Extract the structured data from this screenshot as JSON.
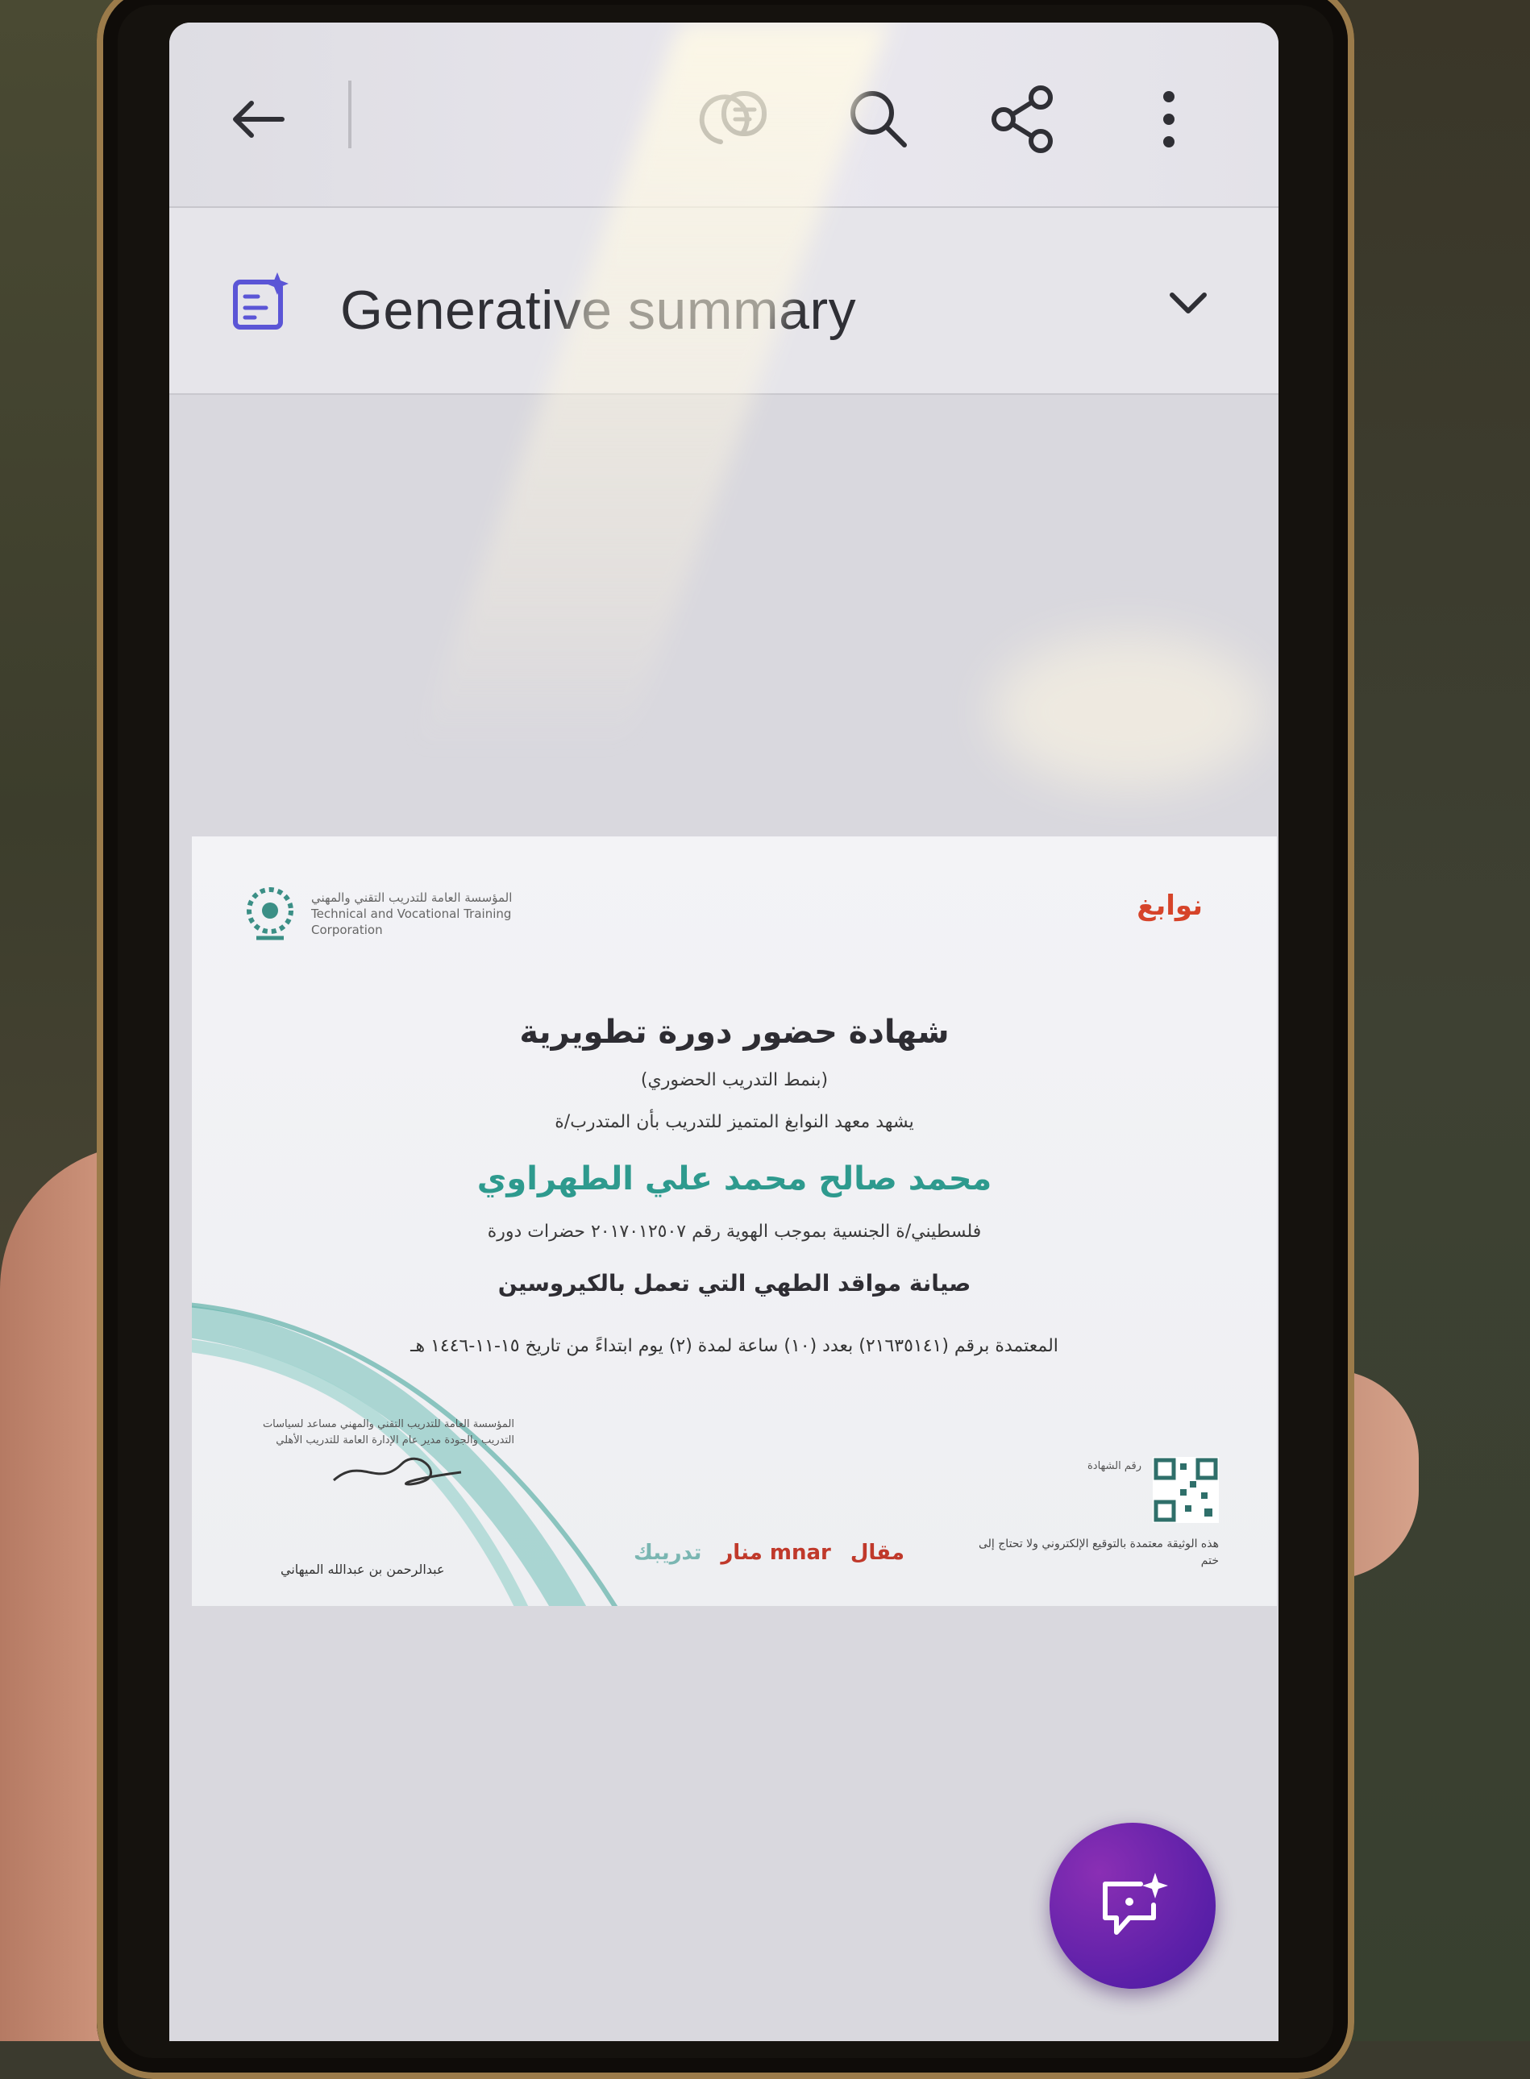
{
  "toolbar": {
    "back_icon": "arrow-left-icon",
    "comment_icon": "comment-bubbles-icon",
    "search_icon": "search-icon",
    "share_icon": "share-icon",
    "more_icon": "more-vertical-icon"
  },
  "summary": {
    "label": "Generative summary",
    "icon": "generative-summary-icon",
    "chevron": "chevron-down-icon"
  },
  "certificate": {
    "title": "شهادة حضور دورة تطويرية",
    "subtitle": "(بنمط التدريب الحضوري)",
    "intro": "يشهد معهد النوابغ المتميز للتدريب بأن المتدرب/ة",
    "name": "محمد صالح محمد علي الطهراوي",
    "nationality_line": "فلسطيني/ة الجنسية بموجب الهوية رقم ٢٠١٧٠١٢٥٠٧ حضرات دورة",
    "course": "صيانة مواقد الطهي التي تعمل بالكيروسين",
    "approved_line": "المعتمدة برقم (٢١٦٣٥١٤١) بعدد (١٠) ساعة لمدة (٢) يوم ابتداءً من تاريخ ١٥-١١-١٤٤٦ هـ",
    "org_left": "المؤسسة العامة للتدريب التقني والمهني Technical and Vocational Training Corporation",
    "org_right_logo": "نوابغ",
    "signature_block": "المؤسسة العامة للتدريب التقني والمهني مساعد لسياسات التدريب والجودة مدير عام الإدارة العامة للتدريب الأهلي",
    "signatory_name": "عبدالرحمن بن عبدالله الميهاني",
    "qr_label": "رقم الشهادة",
    "qr_note": "هذه الوثيقة معتمدة بالتوقيع الإلكتروني ولا تحتاج إلى ختم",
    "logos": [
      "تدريبك",
      "منار mnar",
      "مقال"
    ]
  },
  "fab": {
    "icon": "ai-assistant-chat-icon"
  }
}
